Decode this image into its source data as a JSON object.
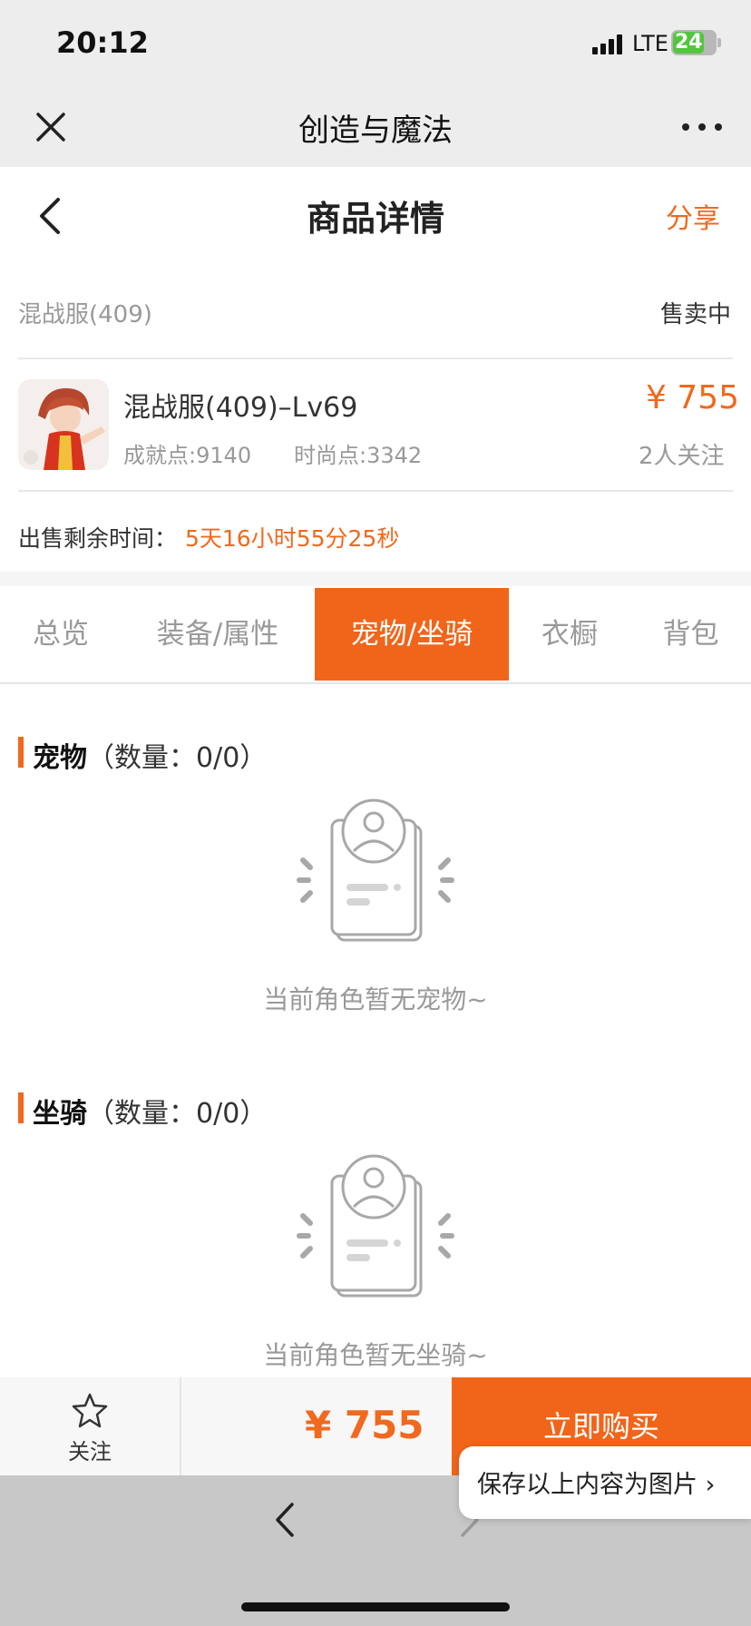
{
  "status_bar": {
    "time": "20:12",
    "network": "LTE",
    "battery": "24"
  },
  "wechat_nav": {
    "title": "创造与魔法"
  },
  "page_header": {
    "title": "商品详情",
    "share_label": "分享"
  },
  "listing": {
    "server": "混战服(409)",
    "status": "售卖中",
    "name": "混战服(409)–Lv69",
    "achievement": "成就点:9140",
    "fashion": "时尚点:3342",
    "price": "¥ 755",
    "followers": "2人关注",
    "remaining_label": "出售剩余时间：",
    "remaining_value": "5天16小时55分25秒"
  },
  "tabs": [
    {
      "label": "总览",
      "active": false
    },
    {
      "label": "装备/属性",
      "active": false
    },
    {
      "label": "宠物/坐骑",
      "active": true
    },
    {
      "label": "衣橱",
      "active": false
    },
    {
      "label": "背包",
      "active": false
    }
  ],
  "sections": {
    "pets": {
      "title": "宠物",
      "count": "（数量：0/0）",
      "empty_text": "当前角色暂无宠物~"
    },
    "mounts": {
      "title": "坐骑",
      "count": "（数量：0/0）",
      "empty_text": "当前角色暂无坐骑~"
    }
  },
  "bottom_bar": {
    "follow_label": "关注",
    "price": "¥ 755",
    "buy_label": "立即购买"
  },
  "popup": {
    "save_image_label": "保存以上内容为图片 ›"
  },
  "colors": {
    "accent": "#f0651a"
  },
  "icons": [
    "close-icon",
    "more-icon",
    "back-icon",
    "star-icon",
    "empty-profile-icon",
    "browser-back-icon",
    "browser-forward-icon"
  ]
}
